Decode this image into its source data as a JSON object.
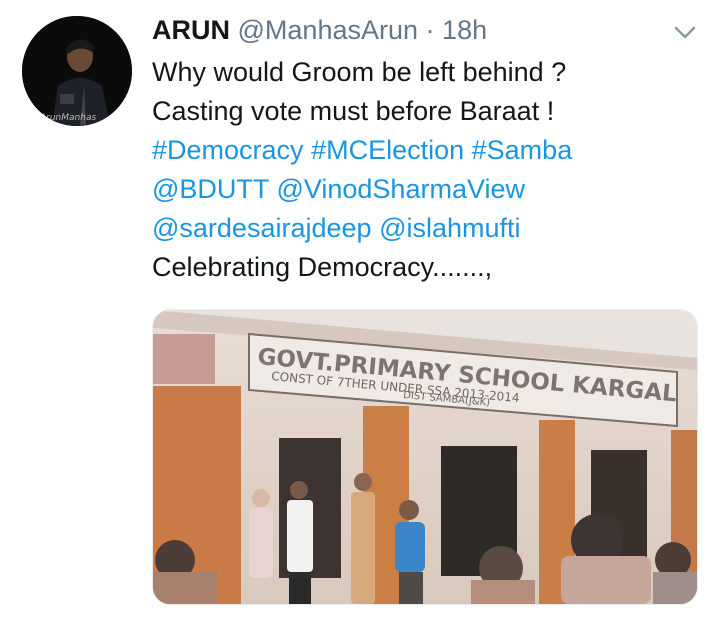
{
  "tweet": {
    "author_name": "ARUN",
    "handle": "@ManhasArun",
    "separator": "·",
    "time": "18h",
    "line1": "Why would Groom be left behind ?",
    "line2": "Casting vote must before Baraat !",
    "hashtags": [
      "#Democracy",
      "#MCElection",
      "#Samba"
    ],
    "mentions_row1": [
      "@BDUTT",
      "@VinodSharmaView"
    ],
    "mentions_row2": [
      "@sardesairajdeep",
      "@islahmufti"
    ],
    "line_last": "Celebrating Democracy.......,"
  },
  "photo": {
    "sign_title": "GOVT.PRIMARY SCHOOL KARGAL",
    "sign_sub1": "CONST OF 7THER UNDER SSA 2013-2014",
    "sign_sub2": "DIST SAMBA(J&K)"
  },
  "icons": {
    "menu": "chevron-down-icon"
  },
  "colors": {
    "link": "#1b95e0",
    "text": "#14171a",
    "muted": "#657786"
  }
}
